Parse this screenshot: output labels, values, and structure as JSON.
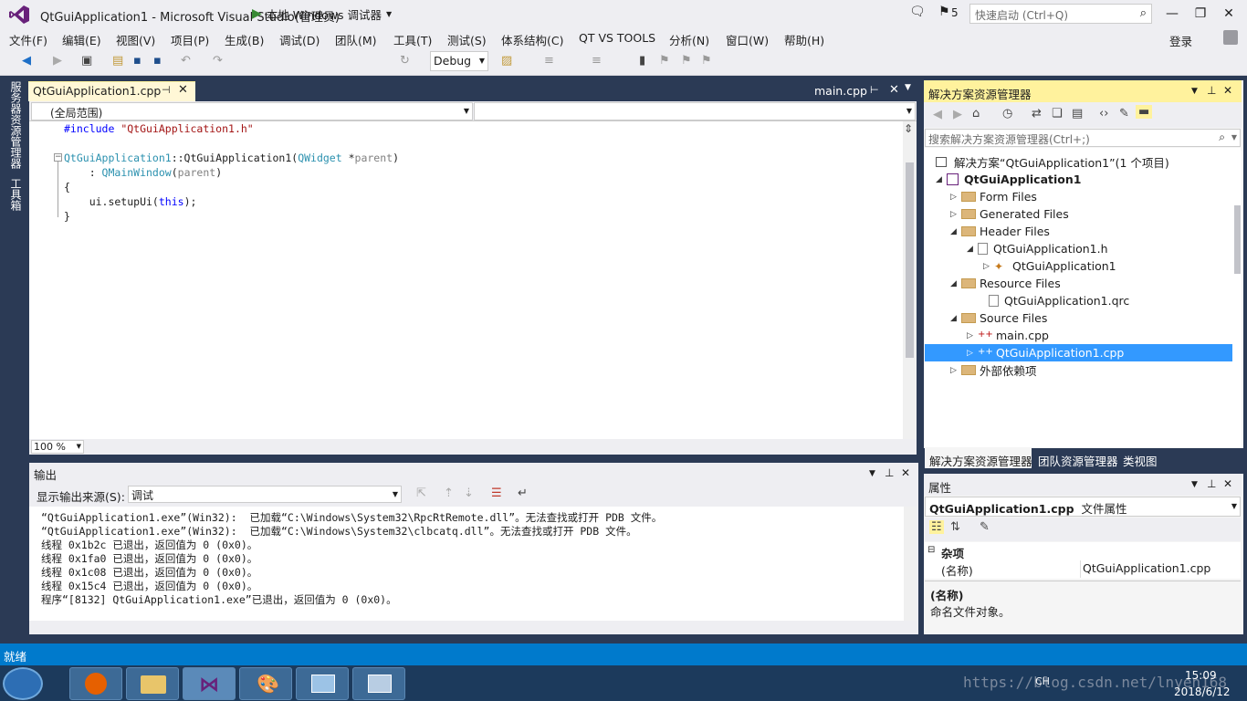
{
  "window": {
    "title": "QtGuiApplication1 - Microsoft Visual Studio(管理员)",
    "notifications_count": "5",
    "quick_launch_placeholder": "快速启动 (Ctrl+Q)"
  },
  "menu": {
    "items": [
      "文件(F)",
      "编辑(E)",
      "视图(V)",
      "项目(P)",
      "生成(B)",
      "调试(D)",
      "团队(M)",
      "工具(T)",
      "测试(S)",
      "体系结构(C)",
      "QT VS TOOLS",
      "分析(N)",
      "窗口(W)",
      "帮助(H)"
    ],
    "login": "登录"
  },
  "toolbar": {
    "run_label": "本地 Windows 调试器",
    "config": "Debug"
  },
  "left_strip": {
    "tabs": [
      "服务器资源管理器",
      "工具箱"
    ]
  },
  "editor": {
    "active_tab": "QtGuiApplication1.cpp",
    "second_tab": "main.cpp",
    "scope": "(全局范围)",
    "zoom": "100 %",
    "code": {
      "line1_kw": "#include",
      "line1_str": "\"QtGuiApplication1.h\"",
      "line2_a": "QtGuiApplication1",
      "line2_b": "::QtGuiApplication1(",
      "line2_c": "QWidget",
      "line2_d": " *",
      "line2_e": "parent",
      "line2_f": ")",
      "line3_a": "    : ",
      "line3_b": "QMainWindow",
      "line3_c": "(",
      "line3_d": "parent",
      "line3_e": ")",
      "line4": "{",
      "line5_a": "    ui.setupUi(",
      "line5_b": "this",
      "line5_c": ");",
      "line6": "}"
    }
  },
  "solution_explorer": {
    "title": "解决方案资源管理器",
    "search_placeholder": "搜索解决方案资源管理器(Ctrl+;)",
    "tree": [
      "解决方案“QtGuiApplication1”(1 个项目)",
      "QtGuiApplication1",
      "Form Files",
      "Generated Files",
      "Header Files",
      "QtGuiApplication1.h",
      "QtGuiApplication1",
      "Resource Files",
      "QtGuiApplication1.qrc",
      "Source Files",
      "main.cpp",
      "QtGuiApplication1.cpp",
      "外部依赖项"
    ],
    "bottom_tabs": [
      "解决方案资源管理器",
      "团队资源管理器",
      "类视图"
    ]
  },
  "properties": {
    "title": "属性",
    "object_name": "QtGuiApplication1.cpp",
    "object_type": "文件属性",
    "category": "杂项",
    "prop_name": "(名称)",
    "prop_value": "QtGuiApplication1.cpp",
    "desc_title": "(名称)",
    "desc_text": "命名文件对象。"
  },
  "output": {
    "title": "输出",
    "source_label": "显示输出来源(S):",
    "source_value": "调试",
    "lines": [
      "“QtGuiApplication1.exe”(Win32):  已加载“C:\\Windows\\System32\\RpcRtRemote.dll”。无法查找或打开 PDB 文件。",
      "“QtGuiApplication1.exe”(Win32):  已加载“C:\\Windows\\System32\\clbcatq.dll”。无法查找或打开 PDB 文件。",
      "线程 0x1b2c 已退出，返回值为 0 (0x0)。",
      "线程 0x1fa0 已退出，返回值为 0 (0x0)。",
      "线程 0x1c08 已退出，返回值为 0 (0x0)。",
      "线程 0x15c4 已退出，返回值为 0 (0x0)。",
      "程序“[8132] QtGuiApplication1.exe”已退出，返回值为 0 (0x0)。"
    ]
  },
  "status": {
    "text": "就绪"
  },
  "taskbar": {
    "time": "15:09",
    "date": "2018/6/12",
    "lang": "CH",
    "watermark": "https://blog.csdn.net/lnyen168"
  },
  "colors": {
    "accent": "#007acc",
    "selected": "#3399ff",
    "active_tab": "#fff29d",
    "chrome_dark": "#2b3a55"
  }
}
